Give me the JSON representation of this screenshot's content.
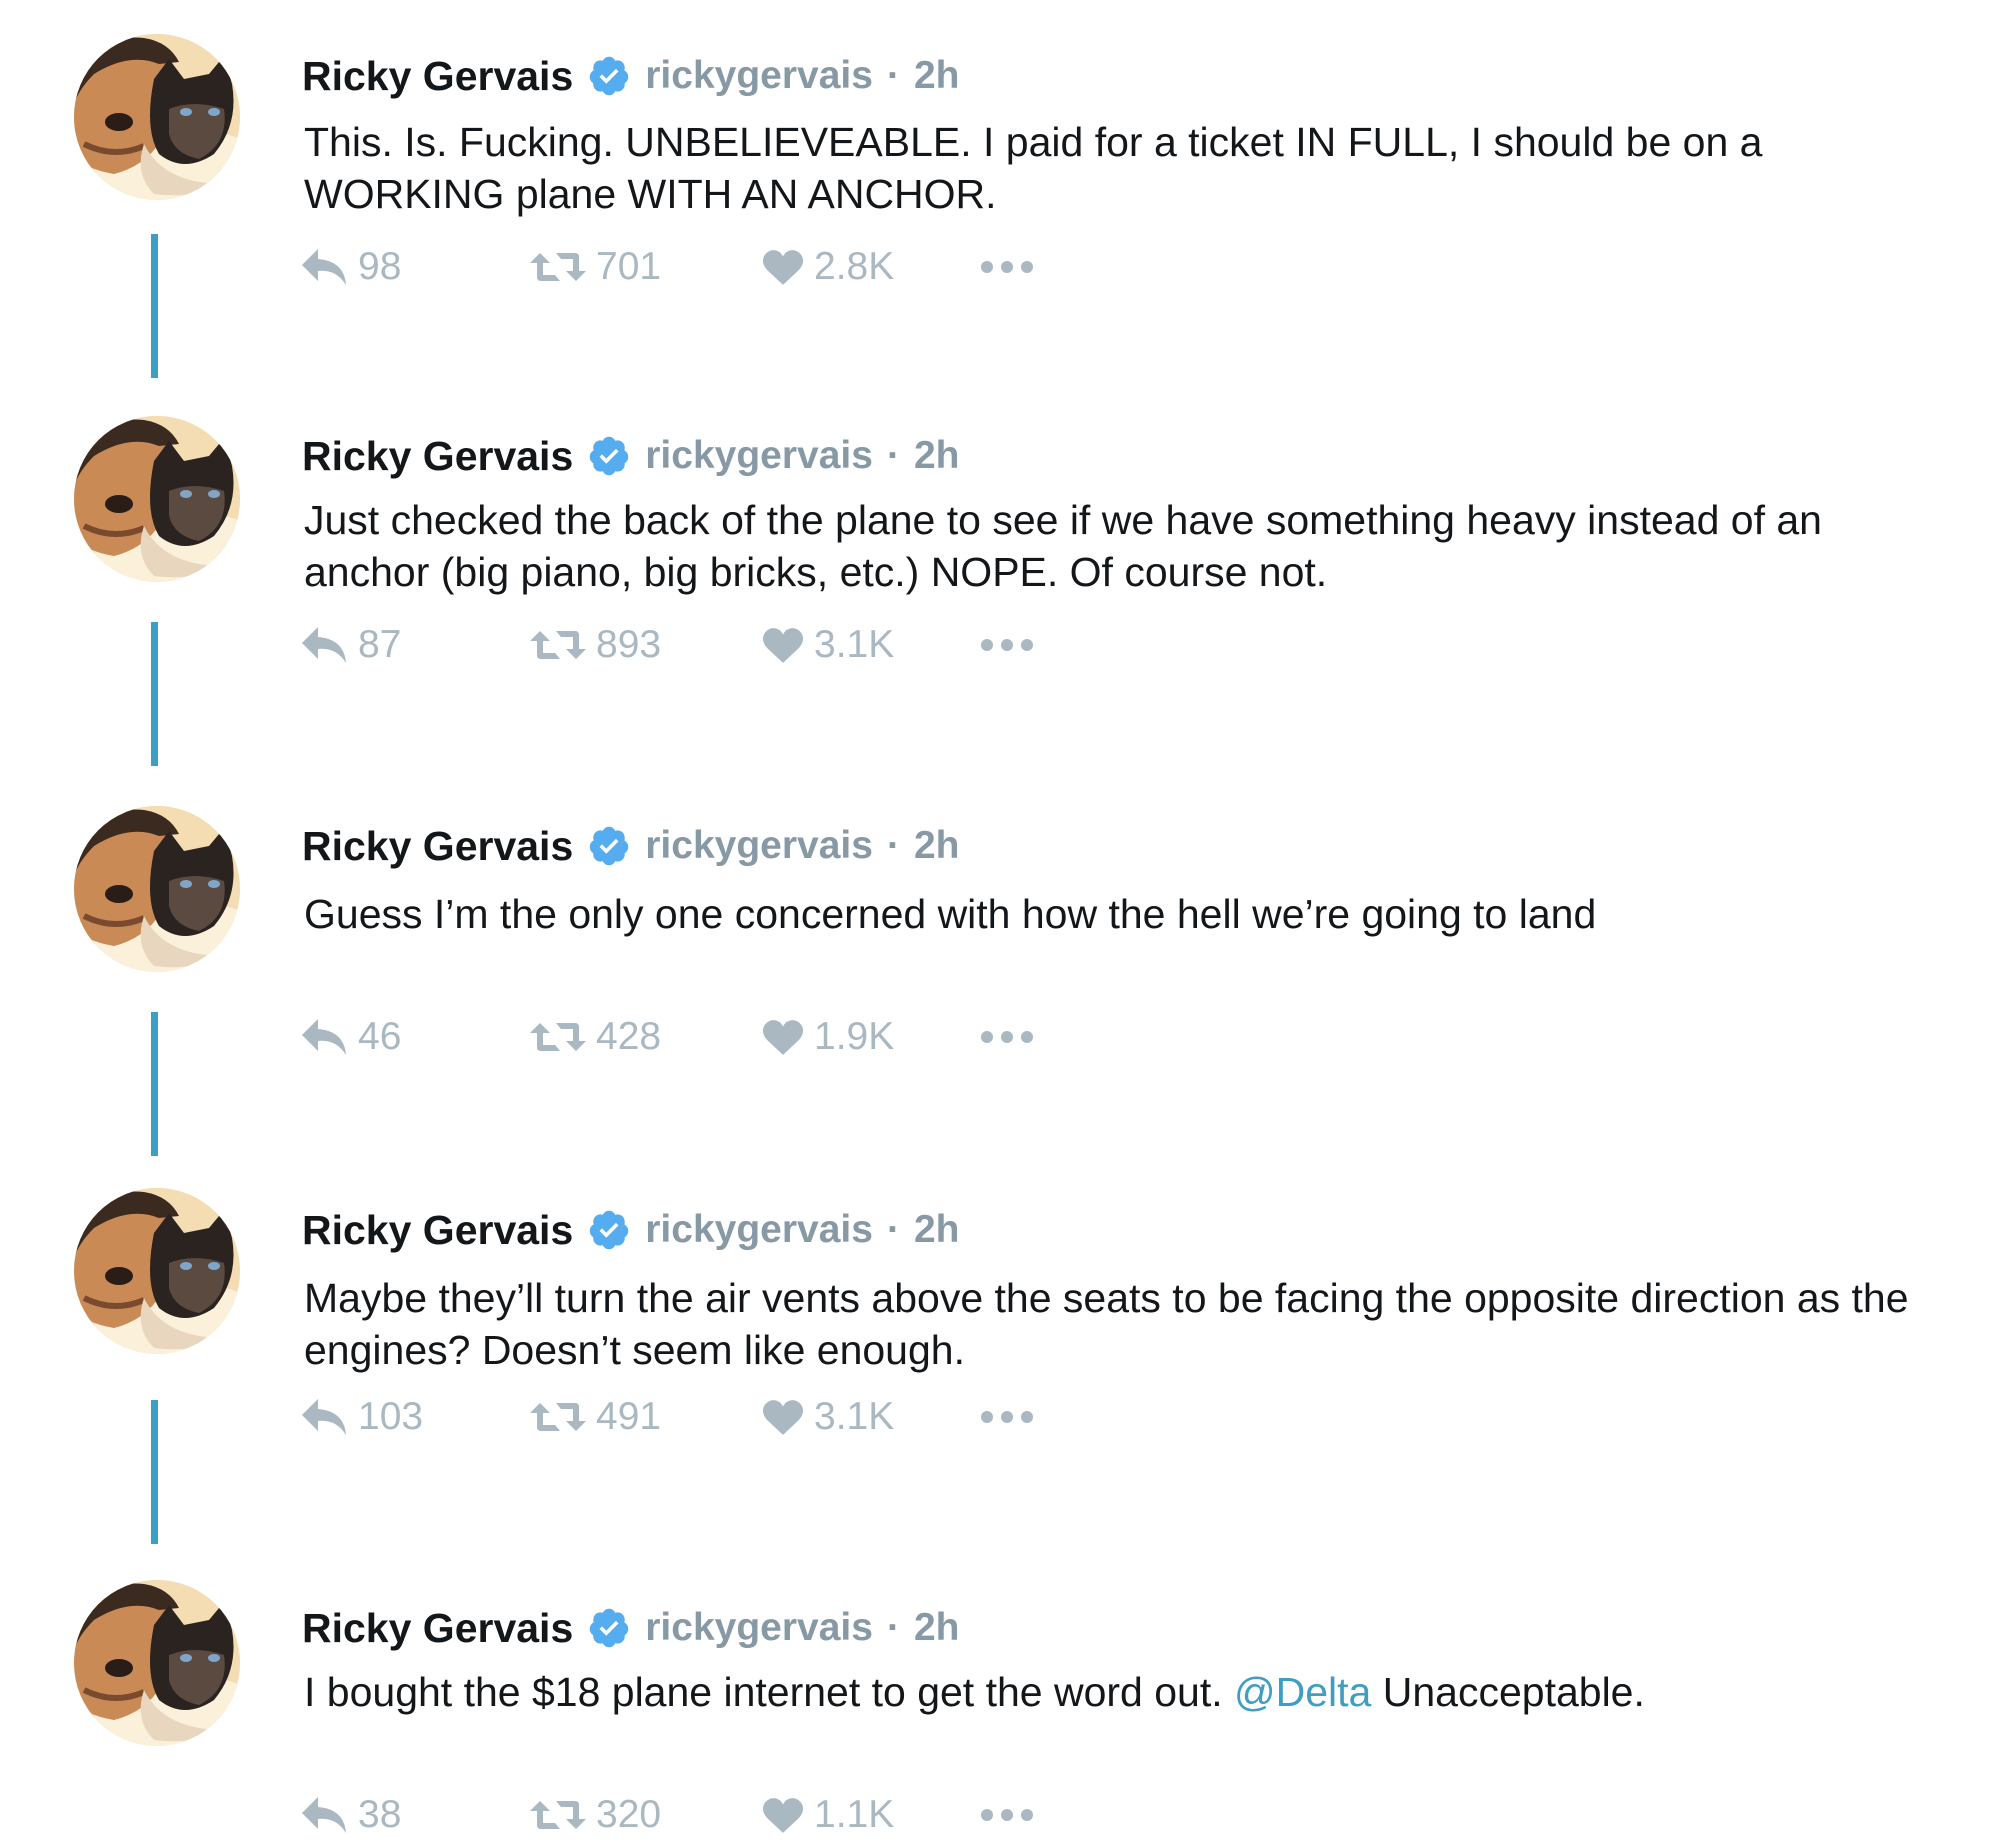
{
  "colors": {
    "thread_line": "#3e9ec4",
    "name_text": "#14171a",
    "meta_text": "#8899a6",
    "action_icon": "#aab8c2",
    "verified_badge": "#55acee",
    "mention": "#3e9ec4"
  },
  "icons": [
    "avatar-photo",
    "verified-badge-icon",
    "reply-icon",
    "retweet-icon",
    "heart-icon",
    "more-icon"
  ],
  "tweets": [
    {
      "name": "Ricky Gervais",
      "handle": "rickygervais",
      "separator": "·",
      "time": "2h",
      "text": "This. Is. Fucking. UNBELIEVEABLE. I paid for a ticket IN FULL, I should be on a WORKING plane WITH AN ANCHOR.",
      "replies": "98",
      "retweets": "701",
      "likes": "2.8K"
    },
    {
      "name": "Ricky Gervais",
      "handle": "rickygervais",
      "separator": "·",
      "time": "2h",
      "text": "Just checked the back of the plane to see if we have something heavy instead of an anchor (big piano, big bricks, etc.) NOPE. Of course not.",
      "replies": "87",
      "retweets": "893",
      "likes": "3.1K"
    },
    {
      "name": "Ricky Gervais",
      "handle": "rickygervais",
      "separator": "·",
      "time": "2h",
      "text": "Guess I’m the only one concerned with how the hell we’re going to land",
      "replies": "46",
      "retweets": "428",
      "likes": "1.9K"
    },
    {
      "name": "Ricky Gervais",
      "handle": "rickygervais",
      "separator": "·",
      "time": "2h",
      "text": "Maybe they’ll turn the air vents above the seats to be facing the opposite direction as the engines? Doesn’t seem like enough.",
      "replies": "103",
      "retweets": "491",
      "likes": "3.1K"
    },
    {
      "name": "Ricky Gervais",
      "handle": "rickygervais",
      "separator": "·",
      "time": "2h",
      "text_before": "I bought the $18 plane internet to get the word out. ",
      "mention": "@Delta",
      "text_after": " Unacceptable.",
      "replies": "38",
      "retweets": "320",
      "likes": "1.1K"
    }
  ]
}
